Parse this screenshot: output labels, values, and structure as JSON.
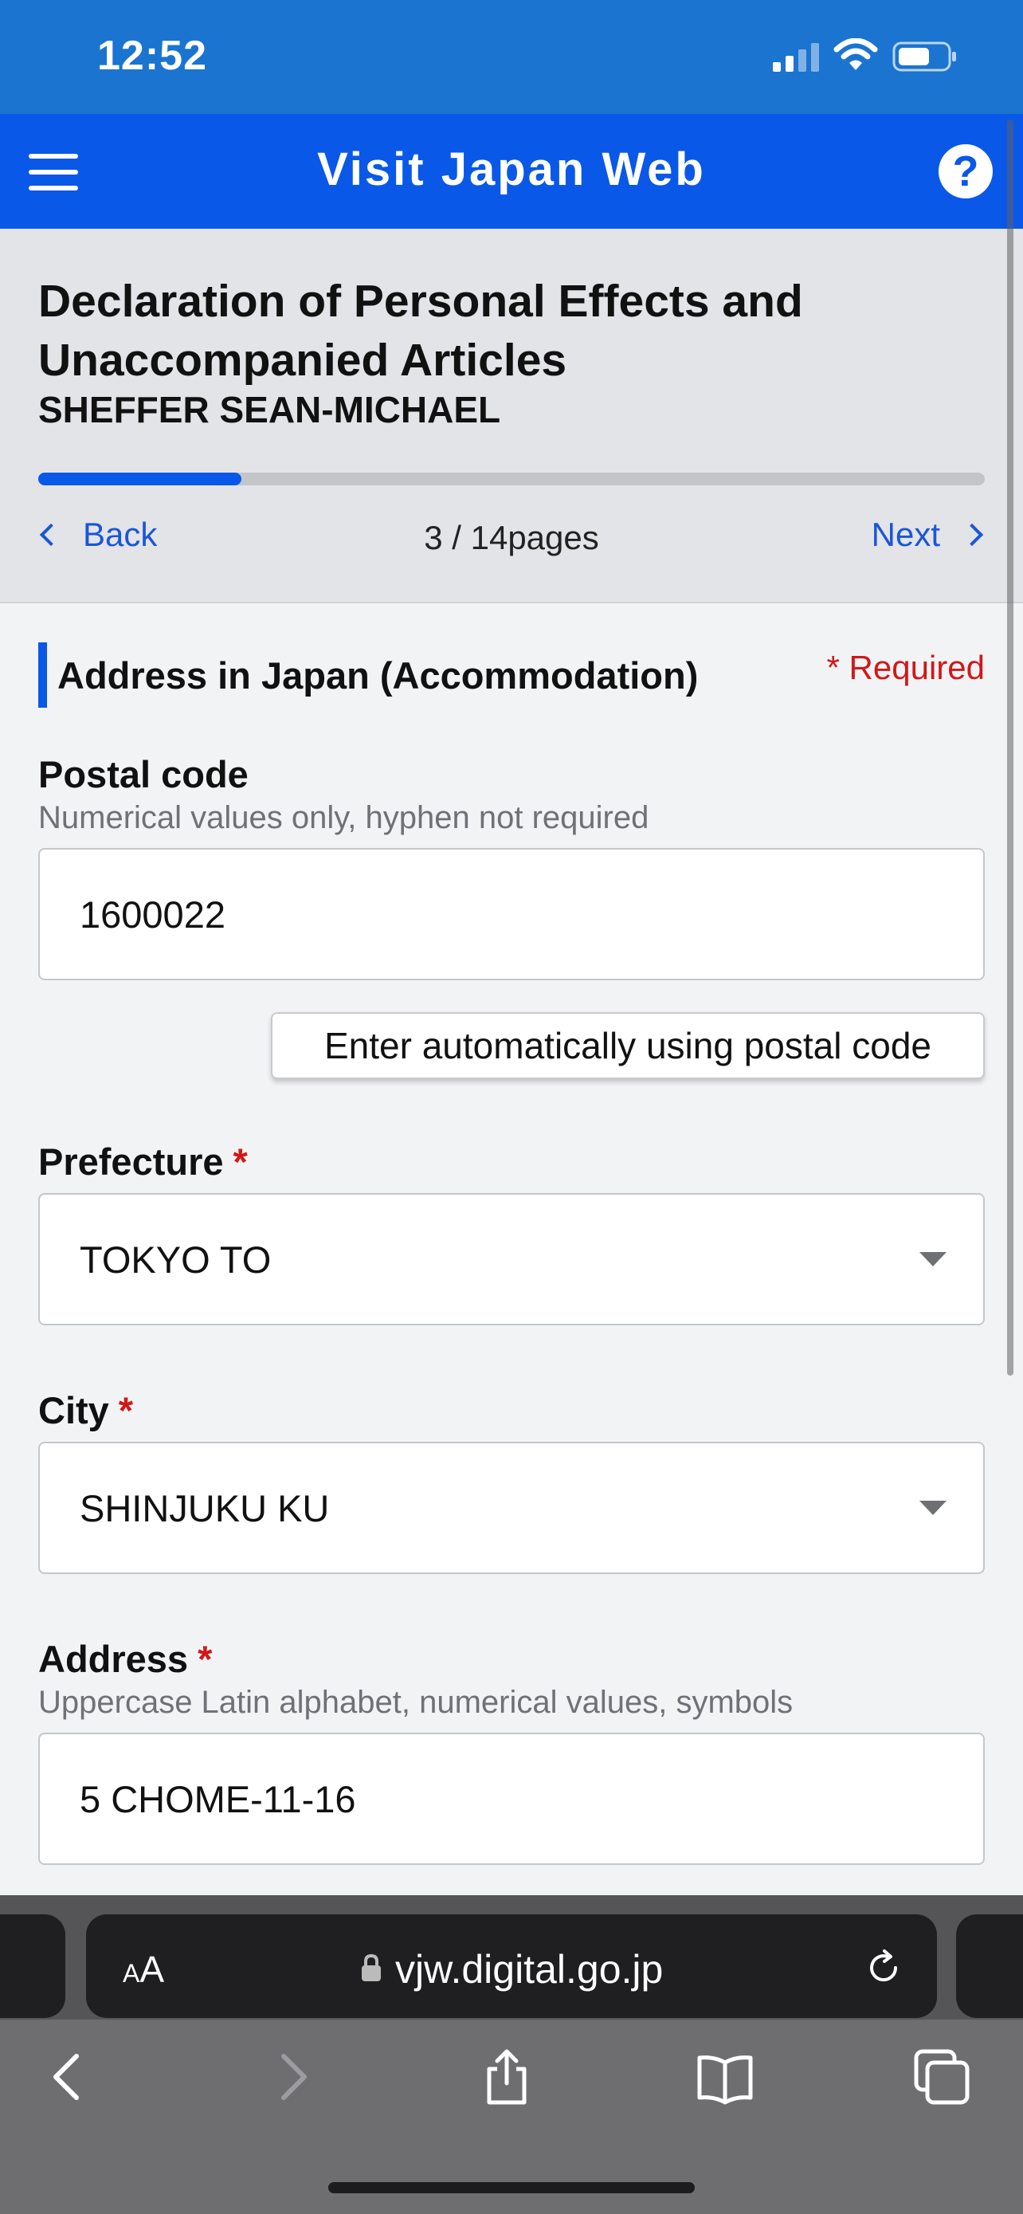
{
  "status_bar": {
    "time": "12:52"
  },
  "header": {
    "title": "Visit Japan Web",
    "help_label": "?"
  },
  "form": {
    "title": "Declaration of Personal Effects and Unaccompanied Articles",
    "traveler_name": "SHEFFER SEAN-MICHAEL",
    "progress": {
      "current": 3,
      "total": 14
    },
    "back_label": "Back",
    "next_label": "Next",
    "page_indicator": "3 / 14pages"
  },
  "section": {
    "title": "Address in Japan (Accommodation)",
    "required_note": "* Required"
  },
  "fields": {
    "postal_code": {
      "label": "Postal code",
      "hint": "Numerical values only, hyphen not required",
      "value": "1600022"
    },
    "auto_fill_button": "Enter automatically using postal code",
    "prefecture": {
      "label": "Prefecture",
      "required_mark": "*",
      "value": "TOKYO TO"
    },
    "city": {
      "label": "City",
      "required_mark": "*",
      "value": "SHINJUKU KU"
    },
    "address": {
      "label": "Address",
      "required_mark": "*",
      "hint": "Uppercase Latin alphabet, numerical values, symbols",
      "value": "5 CHOME-11-16"
    }
  },
  "browser": {
    "text_size_label": "AA",
    "url": "vjw.digital.go.jp",
    "toolbar": [
      "back-icon",
      "forward-icon",
      "share-icon",
      "bookmarks-icon",
      "tabs-icon"
    ]
  },
  "colors": {
    "status_bar": "#1a74d0",
    "header": "#0a58e8",
    "accent": "#0a58e8",
    "link": "#1a56d8",
    "required": "#d01818"
  }
}
